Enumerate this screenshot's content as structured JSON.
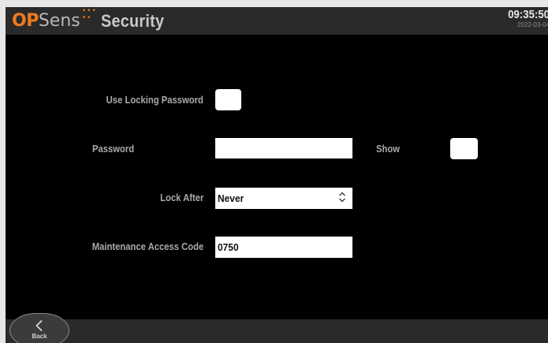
{
  "header": {
    "logo_op": "OP",
    "logo_sens": "Sens",
    "title": "Security",
    "time": "09:35:50",
    "date": "2022-03-04"
  },
  "form": {
    "use_locking_password": {
      "label": "Use Locking Password",
      "checked": false
    },
    "password": {
      "label": "Password",
      "value": ""
    },
    "show": {
      "label": "Show",
      "checked": false
    },
    "lock_after": {
      "label": "Lock After",
      "value": "Never"
    },
    "maintenance_code": {
      "label": "Maintenance Access Code",
      "value": "0750"
    }
  },
  "footer": {
    "back_label": "Back"
  },
  "colors": {
    "accent": "#f07b1e",
    "background": "#000000",
    "bar": "#2a2a2a"
  }
}
